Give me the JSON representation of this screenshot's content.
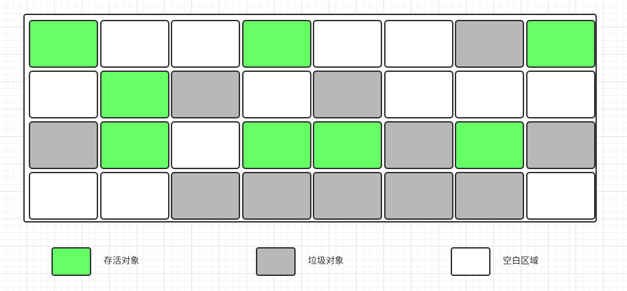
{
  "colors": {
    "live": "#66ff66",
    "garbage": "#b8b8b8",
    "empty": "#ffffff",
    "border": "#333333"
  },
  "grid": {
    "rows": [
      [
        "live",
        "empty",
        "empty",
        "live",
        "empty",
        "empty",
        "garbage",
        "live"
      ],
      [
        "empty",
        "live",
        "garbage",
        "empty",
        "garbage",
        "empty",
        "empty",
        "empty"
      ],
      [
        "garbage",
        "live",
        "empty",
        "live",
        "live",
        "garbage",
        "live",
        "garbage"
      ],
      [
        "empty",
        "empty",
        "garbage",
        "garbage",
        "garbage",
        "garbage",
        "garbage",
        "empty"
      ]
    ]
  },
  "legend": {
    "live_label": "存活对象",
    "garbage_label": "垃圾对象",
    "empty_label": "空白区域"
  }
}
